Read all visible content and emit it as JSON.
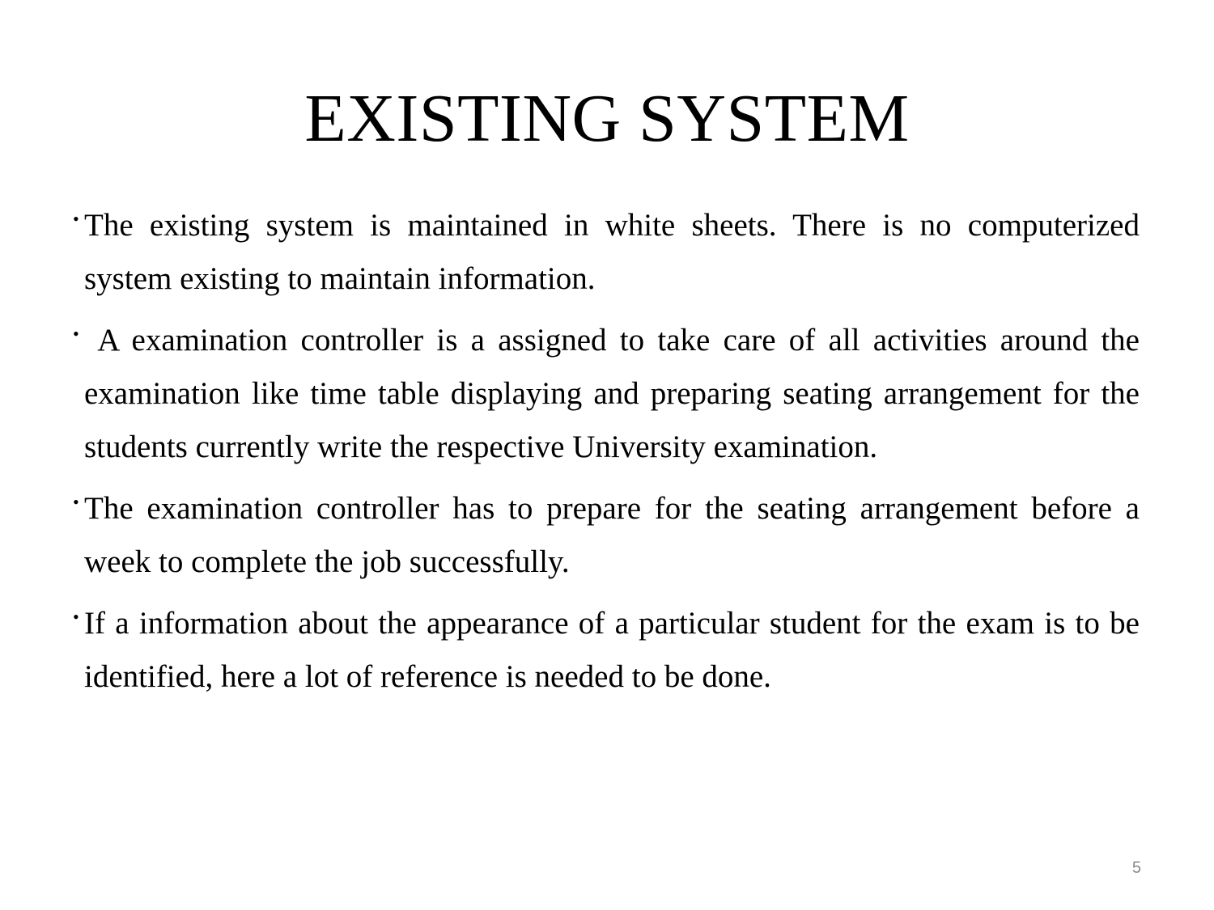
{
  "slide": {
    "title": "EXISTING SYSTEM",
    "bullets": [
      {
        "marker": "•",
        "text": "The existing system is maintained in white sheets. There is no computerized system existing to maintain information."
      },
      {
        "marker": "•",
        "text": " A examination controller is a assigned to take care of all activities around the examination like time table displaying and preparing seating arrangement for the students currently write the respective University examination."
      },
      {
        "marker": "•",
        "text": "The examination controller has to prepare for the seating arrangement before a week to complete the job successfully."
      },
      {
        "marker": "•",
        "text": "If a information about the appearance of a particular student for the exam is to be identified, here a lot of reference is needed to be done."
      }
    ],
    "page_number": "5"
  },
  "colors": {
    "background": "#ffffff",
    "text": "#000000",
    "page_number": "#8a8a8a"
  }
}
